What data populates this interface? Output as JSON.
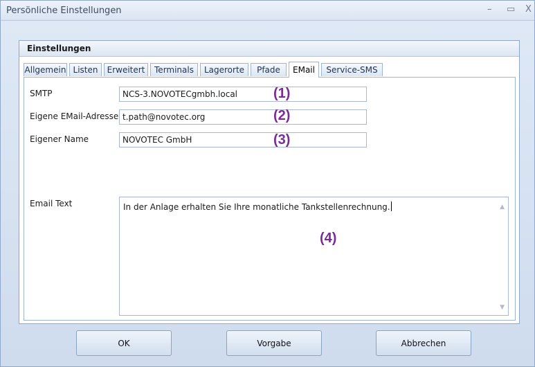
{
  "window": {
    "title": "Persönliche Einstellungen",
    "controls": {
      "minimize": "–",
      "maximize": "▭",
      "close": "X"
    }
  },
  "group": {
    "title": "Einstellungen"
  },
  "tabs": [
    {
      "label": "Allgemein"
    },
    {
      "label": "Listen"
    },
    {
      "label": "Erweitert"
    },
    {
      "label": "Terminals"
    },
    {
      "label": "Lagerorte"
    },
    {
      "label": "Pfade"
    },
    {
      "label": "EMail",
      "active": true
    },
    {
      "label": "Service-SMS"
    }
  ],
  "email_tab": {
    "smtp": {
      "label": "SMTP",
      "value": "NCS-3.NOVOTECgmbh.local",
      "marker": "(1)"
    },
    "own_email": {
      "label": "Eigene EMail-Adresse",
      "value": "t.path@novotec.org",
      "marker": "(2)"
    },
    "own_name": {
      "label": "Eigener Name",
      "value": "NOVOTEC GmbH",
      "marker": "(3)"
    },
    "email_text": {
      "label": "Email Text",
      "value": "In der Anlage erhalten Sie Ihre monatliche Tankstellenrechnung.",
      "marker": "(4)"
    }
  },
  "buttons": {
    "ok": "OK",
    "default": "Vorgabe",
    "cancel": "Abbrechen"
  },
  "colors": {
    "annotation": "#7b2a96",
    "window_bg": "#d6e3f3"
  }
}
